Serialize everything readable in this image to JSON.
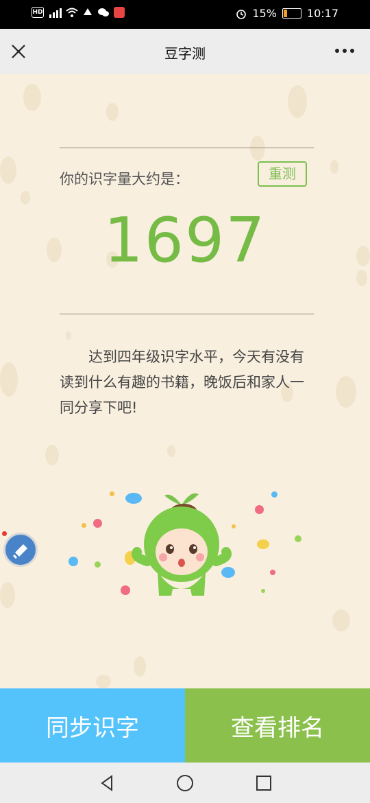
{
  "status_bar": {
    "battery_percent": "15%",
    "time": "10:17",
    "icons": [
      "hd-icon",
      "signal-4g-icon",
      "wifi-icon",
      "app-icon",
      "wechat-icon",
      "notification-app-icon",
      "alarm-icon",
      "battery-icon"
    ]
  },
  "title_bar": {
    "title": "豆字测",
    "close_icon": "close-icon",
    "more_icon": "more-icon"
  },
  "result": {
    "label": "你的识字量大约是：",
    "retest_label": "重测",
    "score": "1697",
    "message": "达到四年级识字水平，今天有没有读到什么有趣的书籍，晚饭后和家人一同分享下吧!"
  },
  "actions": {
    "sync_label": "同步识字",
    "ranking_label": "查看排名"
  },
  "colors": {
    "accent_green": "#76bb46",
    "sync_blue": "#55c3fb",
    "ranking_green": "#8bc04c",
    "background": "#f8efdf"
  }
}
